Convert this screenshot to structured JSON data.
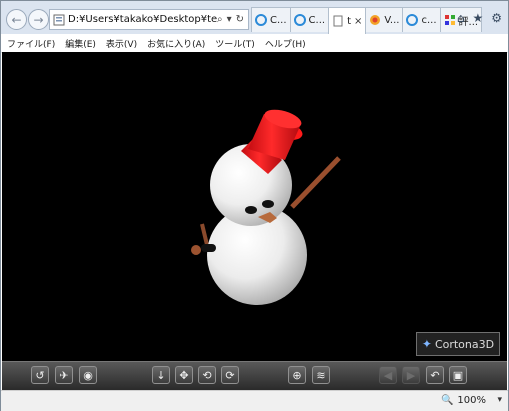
{
  "browser": {
    "address_url": "D:¥Users¥takako¥Desktop¥test.wrl",
    "address_tools": [
      "⌕",
      "▾",
      "↻"
    ],
    "tabs": [
      {
        "label": "C...",
        "active": false
      },
      {
        "label": "C...",
        "active": false
      },
      {
        "label": "t",
        "active": true
      },
      {
        "label": "V...",
        "active": false
      },
      {
        "label": "c...",
        "active": false
      },
      {
        "label": "評...",
        "active": false
      }
    ],
    "close_glyph": "×",
    "right_icons": [
      "home-icon",
      "favorites-icon",
      "settings-icon"
    ]
  },
  "menubar": {
    "items": [
      "ファイル(F)",
      "編集(E)",
      "表示(V)",
      "お気に入り(A)",
      "ツール(T)",
      "ヘルプ(H)"
    ]
  },
  "viewer": {
    "logo_text": "Cortona3D",
    "colors": {
      "background": "#000000",
      "hat": "#e8141b",
      "arm": "#9a4f2e",
      "snow": "#ececec"
    }
  },
  "statusbar": {
    "zoom_label": "100%",
    "zoom_dropdown": "▾"
  }
}
